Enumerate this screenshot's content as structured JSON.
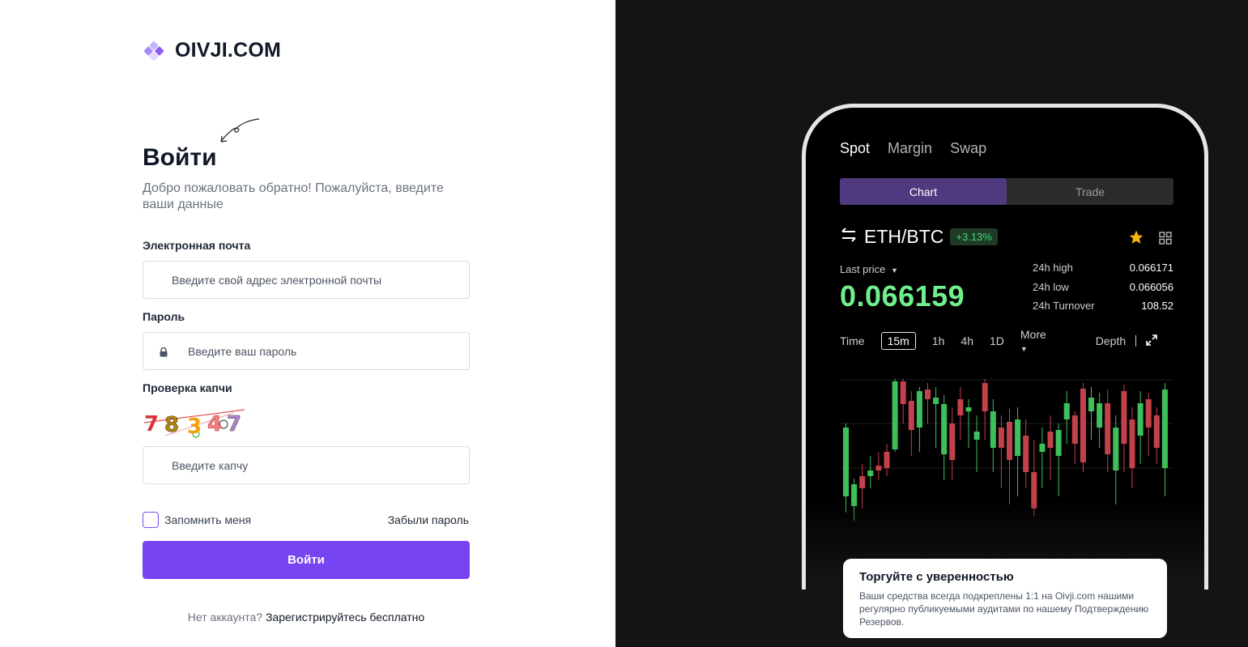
{
  "brand": {
    "name": "OIVJI.COM",
    "logo_icon": "diamond-logo-icon"
  },
  "login": {
    "title": "Войти",
    "subtitle": "Добро пожаловать обратно! Пожалуйста, введите ваши данные",
    "email_label": "Электронная почта",
    "email_placeholder": "Введите свой адрес электронной почты",
    "password_label": "Пароль",
    "password_placeholder": "Введите ваш пароль",
    "captcha_label": "Проверка капчи",
    "captcha_text": "78347",
    "captcha_placeholder": "Введите капчу",
    "remember_label": "Запомнить меня",
    "forgot_label": "Забыли пароль",
    "submit_label": "Войти",
    "no_account_text": "Нет аккаунта?",
    "signup_link": "Зарегистрируйтесь бесплатно"
  },
  "promo": {
    "tabs": [
      "Spot",
      "Margin",
      "Swap"
    ],
    "active_tab": "Spot",
    "segment": [
      "Chart",
      "Trade"
    ],
    "pair": "ETH/BTC",
    "change": "+3.13%",
    "last_price_label": "Last price",
    "last_price": "0.066159",
    "stats": [
      {
        "label": "24h high",
        "value": "0.066171"
      },
      {
        "label": "24h low",
        "value": "0.066056"
      },
      {
        "label": "24h Turnover",
        "value": "108.52"
      }
    ],
    "timeframes": [
      "Time",
      "15m",
      "1h",
      "4h",
      "1D",
      "More"
    ],
    "active_timeframe": "15m",
    "depth_label": "Depth",
    "card_title": "Торгуйте с уверенностью",
    "card_text": "Ваши средства всегда подкреплены 1:1 на Oivji.com нашими регулярно публикуемыми аудитами по нашему Подтверждению Резервов.",
    "colors": {
      "up": "#3fbf5a",
      "down": "#c2414a",
      "accent": "#7744f2"
    }
  }
}
